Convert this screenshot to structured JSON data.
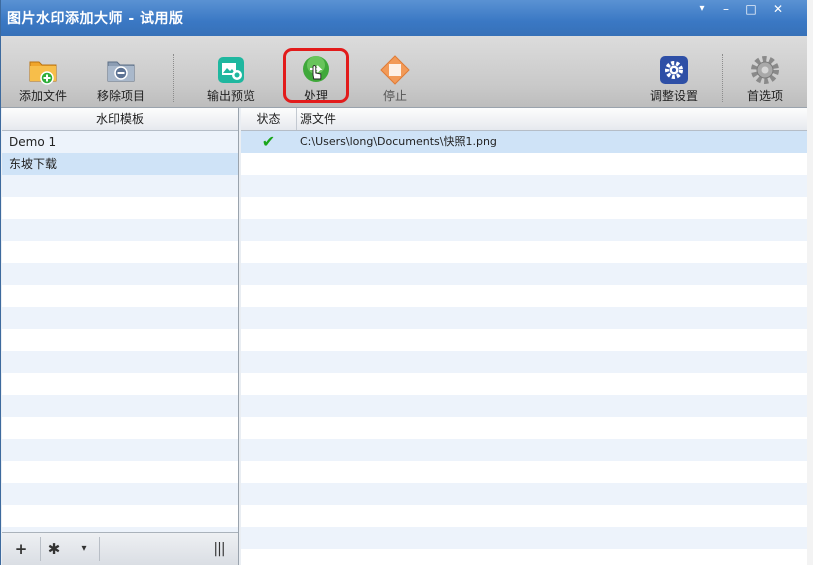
{
  "window": {
    "title": "图片水印添加大师 - 试用版",
    "controls": {
      "menu": "▾",
      "minimize": "–",
      "maximize": "□",
      "close": "✕"
    }
  },
  "toolbar": {
    "add_file": "添加文件",
    "remove_item": "移除项目",
    "output_preview": "输出预览",
    "process": "处理",
    "stop": "停止",
    "adjust_settings": "调整设置",
    "preferences": "首选项"
  },
  "left_panel": {
    "header": "水印模板",
    "templates": [
      "Demo 1",
      "东坡下载"
    ],
    "selected_index": 1,
    "footer": {
      "add": "+",
      "settings": "✱",
      "dropdown": "▾",
      "columns": "|||"
    }
  },
  "right_panel": {
    "headers": {
      "status": "状态",
      "source": "源文件"
    },
    "files": [
      {
        "status": "✔",
        "source": "C:\\Users\\long\\Documents\\快照1.png"
      }
    ]
  },
  "colors": {
    "accent": "#3a78c4",
    "highlight": "#e21b1b",
    "success": "#1aa61a"
  }
}
